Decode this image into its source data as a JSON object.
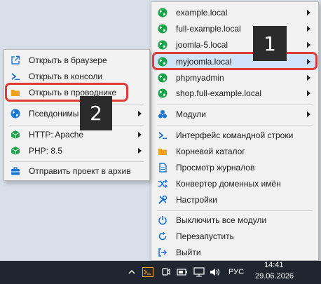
{
  "main_menu": {
    "items": [
      {
        "label": "example.local",
        "icon": "globe-icon",
        "submenu": true
      },
      {
        "label": "full-example.local",
        "icon": "globe-icon",
        "submenu": true
      },
      {
        "label": "joomla-5.local",
        "icon": "globe-icon",
        "submenu": true
      },
      {
        "label": "myjoomla.local",
        "icon": "globe-icon",
        "submenu": true,
        "selected": true
      },
      {
        "label": "phpmyadmin",
        "icon": "globe-icon",
        "submenu": true
      },
      {
        "label": "shop.full-example.local",
        "icon": "globe-icon",
        "submenu": true
      },
      {
        "label": "Модули",
        "icon": "modules-icon",
        "submenu": true
      },
      {
        "label": "Интерфейс командной строки",
        "icon": "terminal-icon",
        "submenu": false
      },
      {
        "label": "Корневой каталог",
        "icon": "folder-icon",
        "submenu": false
      },
      {
        "label": "Просмотр журналов",
        "icon": "document-icon",
        "submenu": false
      },
      {
        "label": "Конвертер доменных имён",
        "icon": "shuffle-icon",
        "submenu": false
      },
      {
        "label": "Настройки",
        "icon": "tools-icon",
        "submenu": false
      },
      {
        "label": "Выключить все модули",
        "icon": "power-icon",
        "submenu": false
      },
      {
        "label": "Перезапустить",
        "icon": "restart-icon",
        "submenu": false
      },
      {
        "label": "Выйти",
        "icon": "exit-icon",
        "submenu": false
      }
    ]
  },
  "sub_menu": {
    "items": [
      {
        "label": "Открыть в браузере",
        "icon": "external-link-icon",
        "submenu": false
      },
      {
        "label": "Открыть в консоли",
        "icon": "terminal-icon",
        "submenu": false
      },
      {
        "label": "Открыть в проводнике",
        "icon": "folder-icon",
        "submenu": false
      },
      {
        "label": "Псевдонимы",
        "icon": "globe-icon",
        "submenu": true
      },
      {
        "label": "HTTP: Apache",
        "icon": "cube-icon",
        "submenu": true
      },
      {
        "label": "PHP: 8.5",
        "icon": "cube-icon",
        "submenu": true
      },
      {
        "label": "Отправить проект в архив",
        "icon": "briefcase-icon",
        "submenu": false
      }
    ]
  },
  "annotations": {
    "badge1": "1",
    "badge2": "2"
  },
  "taskbar": {
    "language": "РУС",
    "time": "14:41",
    "date": "29.06.2026"
  },
  "colors": {
    "accent_red": "#e03a3a",
    "selection": "#cfe4f8",
    "globe_green": "#1aa34a",
    "icon_blue": "#1976d2",
    "folder_orange": "#f0a020"
  }
}
